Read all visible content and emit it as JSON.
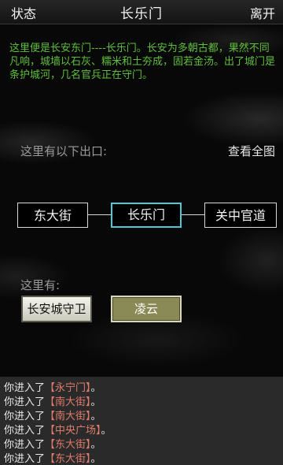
{
  "topbar": {
    "status_label": "状态",
    "title": "长乐门",
    "leave_label": "离开"
  },
  "room": {
    "description": "这里便是长安东门----长乐门。长安为多朝古都，果然不同凡响，城墙以石灰、糯米和土夯成，固若金汤。出了城门是条护城河，几名官兵正在守门。",
    "exits_label": "这里有以下出口:",
    "map_link": "查看全图",
    "exits": {
      "west": "东大街",
      "current": "长乐门",
      "east": "关中官道"
    },
    "here_label": "这里有:",
    "npcs": [
      "长安城守卫",
      "凌云"
    ]
  },
  "log": {
    "prefix": "你进入了",
    "suffix": "。",
    "entries": [
      {
        "text": "你进入了",
        "loc": "【永宁门】",
        "end": "。"
      },
      {
        "text": "你进入了",
        "loc": "【南大街】",
        "end": "。"
      },
      {
        "text": "你进入了",
        "loc": "【南大街】",
        "end": "。"
      },
      {
        "text": "你进入了",
        "loc": "【中央广场】",
        "end": "。"
      },
      {
        "text": "你进入了",
        "loc": "【东大街】",
        "end": "。"
      },
      {
        "text": "你进入了",
        "loc": "【东大街】",
        "end": "。"
      }
    ]
  },
  "colors": {
    "description_text": "#5fbf3a",
    "current_exit_border": "#4ec9d6",
    "log_location": "#e07a6a"
  }
}
